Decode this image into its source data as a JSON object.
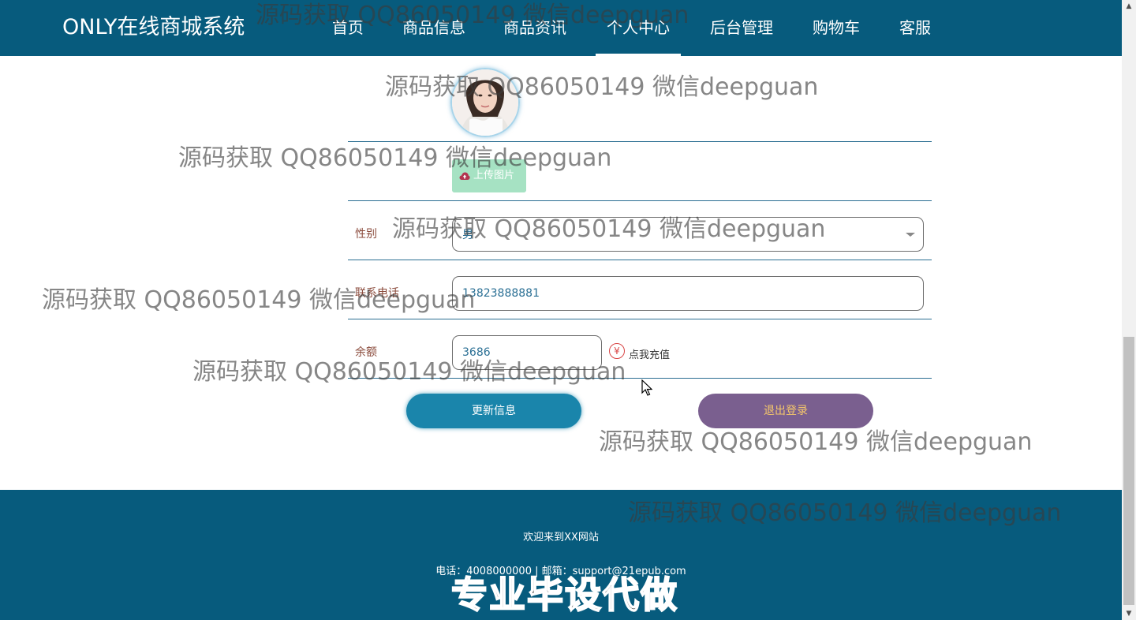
{
  "header": {
    "brand": "ONLY在线商城系统",
    "nav": [
      {
        "label": "首页"
      },
      {
        "label": "商品信息"
      },
      {
        "label": "商品资讯"
      },
      {
        "label": "个人中心",
        "active": true
      },
      {
        "label": "后台管理"
      },
      {
        "label": "购物车"
      },
      {
        "label": "客服"
      }
    ]
  },
  "form": {
    "upload_label": "上传图片",
    "gender": {
      "label": "性别",
      "value": "男"
    },
    "phone": {
      "label": "联系电话",
      "value": "13823888881"
    },
    "balance": {
      "label": "余额",
      "value": "3686",
      "recharge_label": "点我充值"
    },
    "update_button": "更新信息",
    "logout_button": "退出登录"
  },
  "footer": {
    "welcome": "欢迎来到XX网站",
    "contact": "电话：4008000000 | 邮箱：support@21epub.com"
  },
  "watermarks": {
    "text": "源码获取 QQ86050149 微信deepguan",
    "banner": "专业毕设代做"
  },
  "colors": {
    "header_bg": "#075b7d",
    "footer_bg": "#075b7d",
    "update_button": "#1a85ab",
    "logout_button": "#7a5f8f",
    "upload_button": "#a6e2c3"
  }
}
